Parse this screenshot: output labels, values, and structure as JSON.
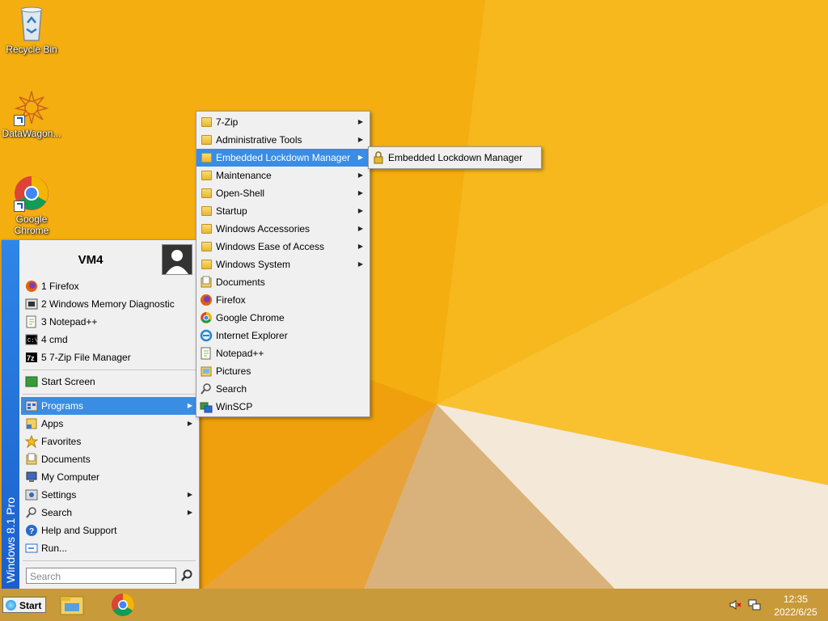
{
  "desktop": {
    "icons": [
      {
        "label": "Recycle Bin"
      },
      {
        "label": "DataWagon..."
      },
      {
        "label": "Google Chrome"
      }
    ]
  },
  "start_menu": {
    "edition": "Windows 8.1 Pro",
    "user": "VM4",
    "recent": [
      {
        "label": "1 Firefox",
        "icon": "firefox-icon"
      },
      {
        "label": "2 Windows Memory Diagnostic",
        "icon": "memory-diagnostic-icon"
      },
      {
        "label": "3 Notepad++",
        "icon": "notepad-plus-plus-icon"
      },
      {
        "label": "4 cmd",
        "icon": "cmd-icon"
      },
      {
        "label": "5 7-Zip File Manager",
        "icon": "7zip-icon"
      }
    ],
    "start_screen": "Start Screen",
    "items": [
      {
        "label": "Programs",
        "has_sub": true
      },
      {
        "label": "Apps",
        "has_sub": true
      },
      {
        "label": "Favorites",
        "has_sub": false
      },
      {
        "label": "Documents",
        "has_sub": false
      },
      {
        "label": "My Computer",
        "has_sub": false
      },
      {
        "label": "Settings",
        "has_sub": true
      },
      {
        "label": "Search",
        "has_sub": true
      },
      {
        "label": "Help and Support",
        "has_sub": false
      },
      {
        "label": "Run...",
        "has_sub": false
      }
    ],
    "search_placeholder": "Search"
  },
  "programs_menu": {
    "folders": [
      "7-Zip",
      "Administrative Tools",
      "Embedded Lockdown Manager",
      "Maintenance",
      "Open-Shell",
      "Startup",
      "Windows Accessories",
      "Windows Ease of Access",
      "Windows System"
    ],
    "apps": [
      "Documents",
      "Firefox",
      "Google Chrome",
      "Internet Explorer",
      "Notepad++",
      "Pictures",
      "Search",
      "WinSCP"
    ]
  },
  "lockdown_menu": {
    "item": "Embedded Lockdown Manager"
  },
  "taskbar": {
    "start_label": "Start",
    "time": "12:35",
    "date": "2022/6/25"
  },
  "colors": {
    "wallpaper": "#f5ae10",
    "highlight": "#3a8de4",
    "side_band": "#1a5fcc"
  }
}
